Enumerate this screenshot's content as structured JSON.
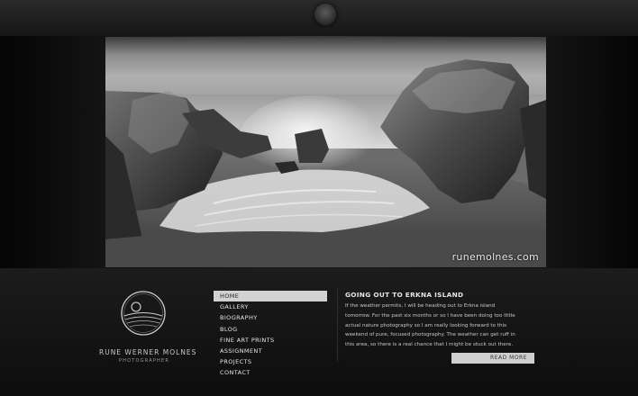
{
  "site": {
    "brand_name": "RUNE WERNER MOLNES",
    "brand_subtitle": "PHOTOGRAPHER",
    "watermark": "runemolnes.com"
  },
  "nav": {
    "items": [
      {
        "label": "HOME",
        "active": true
      },
      {
        "label": "GALLERY"
      },
      {
        "label": "BIOGRAPHY"
      },
      {
        "label": "BLOG"
      },
      {
        "label": "FINE ART PRINTS"
      },
      {
        "label": "ASSIGNMENT"
      },
      {
        "label": "PROJECTS"
      },
      {
        "label": "CONTACT"
      }
    ]
  },
  "post": {
    "title": "GOING OUT TO ERKNA ISLAND",
    "lines": [
      "If the weather permits, I will be heading out to Erkna island",
      "tomorrow. For the past six months or so I have been doing too little",
      "actual nature photography so I am really looking forward to this",
      "weekend of pure, focused photography. The weather can get ruff in",
      "this area, so there is a real chance that I might be stuck out there."
    ],
    "read_more": "READ MORE"
  },
  "colors": {
    "background": "#0b0b0b",
    "nav_active_bg": "#d2d2d2",
    "button_bg": "#cfcfcf"
  }
}
